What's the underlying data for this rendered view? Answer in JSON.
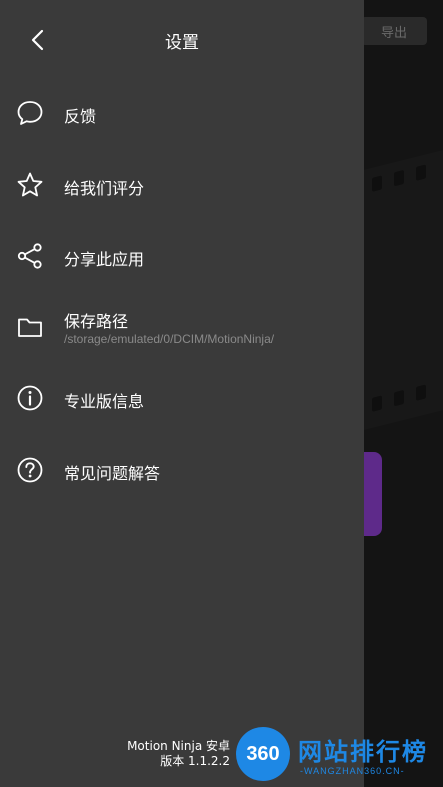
{
  "background": {
    "export_label": "导出"
  },
  "drawer": {
    "title": "设置",
    "items": [
      {
        "label": "反馈",
        "icon": "chat-bubble-icon"
      },
      {
        "label": "给我们评分",
        "icon": "star-icon"
      },
      {
        "label": "分享此应用",
        "icon": "share-icon"
      },
      {
        "label": "保存路径",
        "sublabel": "/storage/emulated/0/DCIM/MotionNinja/",
        "icon": "folder-icon"
      },
      {
        "label": "专业版信息",
        "icon": "info-icon"
      },
      {
        "label": "常见问题解答",
        "icon": "help-icon"
      }
    ],
    "version_app": "Motion Ninja 安卓",
    "version_number": "版本 1.1.2.2"
  },
  "watermark": {
    "badge": "360",
    "title": "网站排行榜",
    "url": "-WANGZHAN360.CN-"
  },
  "colors": {
    "drawer_bg": "#3a3a3a",
    "backdrop": "#141414",
    "accent_purple": "#5e2a8a",
    "watermark_blue": "#1e88e5"
  }
}
